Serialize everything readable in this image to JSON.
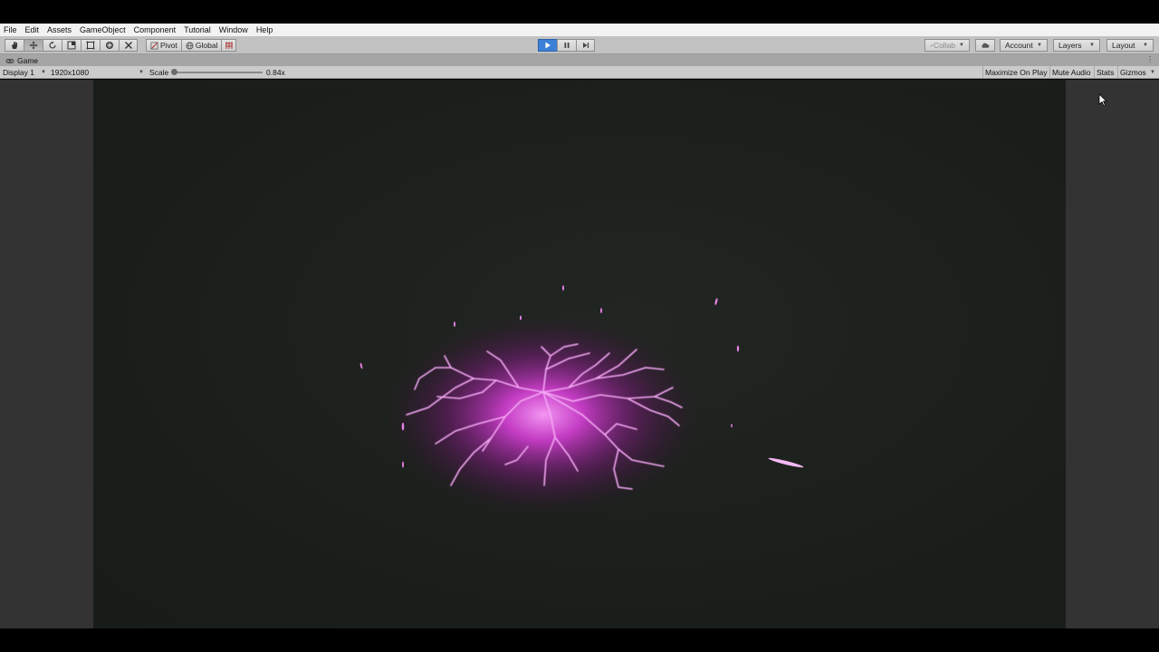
{
  "menu": [
    "File",
    "Edit",
    "Assets",
    "GameObject",
    "Component",
    "Tutorial",
    "Window",
    "Help"
  ],
  "toolbar": {
    "pivot_label": "Pivot",
    "global_label": "Global",
    "collab_label": "Collab",
    "account_label": "Account",
    "layers_label": "Layers",
    "layout_label": "Layout",
    "play_state": "playing"
  },
  "tab": {
    "title": "Game"
  },
  "gamebar": {
    "display": "Display 1",
    "resolution": "1920x1080",
    "scale_label": "Scale",
    "scale_value": "0.84x",
    "maximize_label": "Maximize On Play",
    "mute_label": "Mute Audio",
    "stats_label": "Stats",
    "gizmos_label": "Gizmos"
  },
  "colors": {
    "play_active": "#3b80d6",
    "effect_magenta": "#e040e0",
    "game_background": "#1b1f1b"
  }
}
